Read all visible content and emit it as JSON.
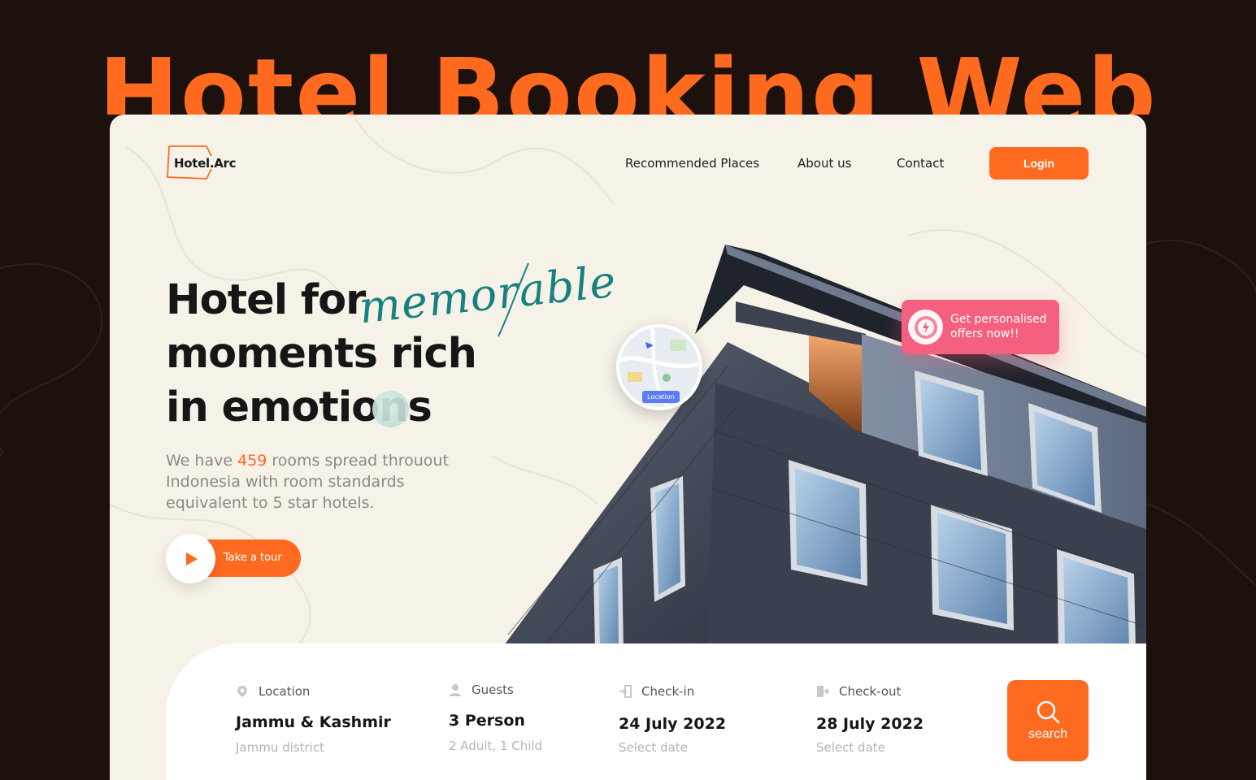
{
  "poster": {
    "title": "Hotel Booking Web"
  },
  "brand": {
    "name": "Hotel.Arc"
  },
  "nav": {
    "items": [
      "Recommended Places",
      "About us",
      "Contact"
    ],
    "login_label": "Login"
  },
  "hero": {
    "line1": "Hotel for",
    "script_word": "memorable",
    "line2": "moments rich",
    "line3": "in emotions",
    "sub_before": "We have ",
    "sub_number": "459",
    "sub_after": " rooms spread throuout Indonesia with room standards equivalent to 5 star hotels.",
    "tour_label": "Take a tour"
  },
  "map": {
    "label": "Location"
  },
  "offer": {
    "text": "Get personalised offers now!!"
  },
  "booking": {
    "location": {
      "label": "Location",
      "value": "Jammu & Kashmir",
      "sub": "Jammu district"
    },
    "guests": {
      "label": "Guests",
      "value": "3 Person",
      "sub": "2 Adult, 1 Child"
    },
    "checkin": {
      "label": "Check-in",
      "value": "24 July 2022",
      "sub": "Select date"
    },
    "checkout": {
      "label": "Check-out",
      "value": "28 July 2022",
      "sub": "Select date"
    },
    "search_label": "search"
  },
  "colors": {
    "accent": "#ff6a21",
    "script": "#17817f",
    "offer": "#f5607e",
    "cream": "#f6f2e8",
    "dark": "#1c110d"
  }
}
